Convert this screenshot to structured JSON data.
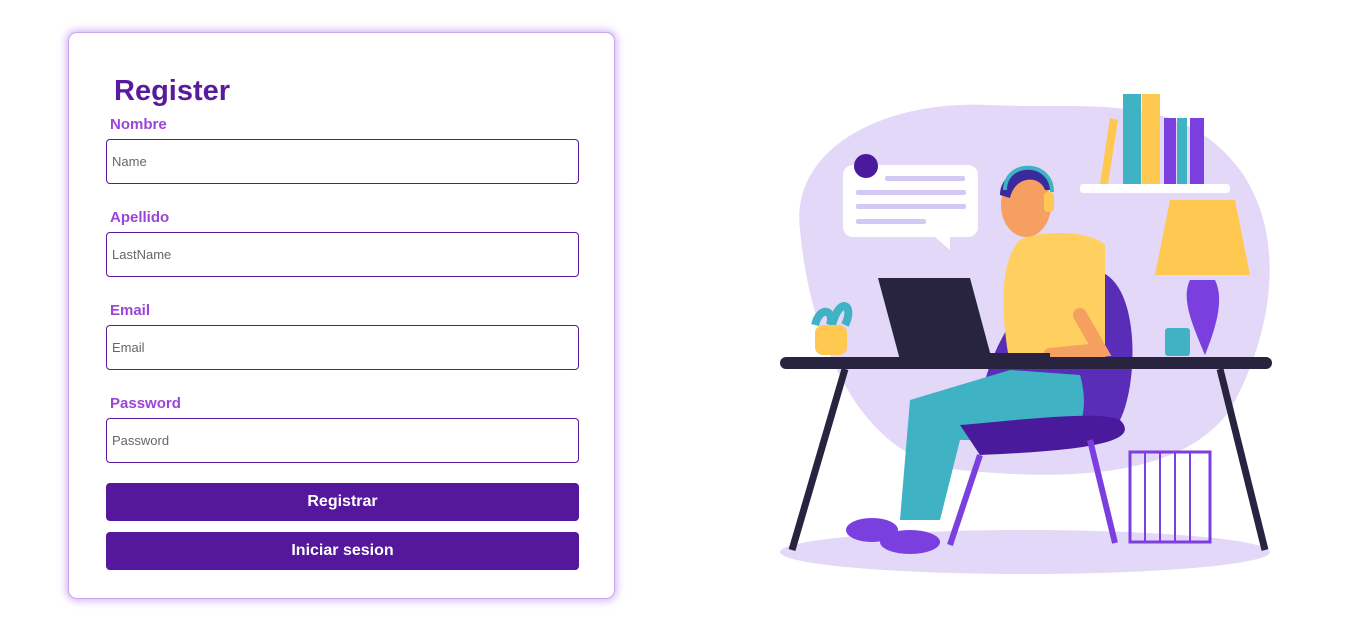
{
  "form": {
    "title": "Register",
    "fields": [
      {
        "label": "Nombre",
        "placeholder": "Name",
        "value": ""
      },
      {
        "label": "Apellido",
        "placeholder": "LastName",
        "value": ""
      },
      {
        "label": "Email",
        "placeholder": "Email",
        "value": ""
      },
      {
        "label": "Password",
        "placeholder": "Password",
        "value": ""
      }
    ],
    "register_button": "Registrar",
    "login_button": "Iniciar sesion"
  },
  "colors": {
    "primary": "#55179b",
    "title": "#5a1a9c",
    "label": "#9b45d6",
    "card_glow": "#c9a5f2",
    "illustration_bg": "#e3d8f7"
  },
  "illustration": {
    "subject": "person-with-headset-at-laptop-icon"
  }
}
